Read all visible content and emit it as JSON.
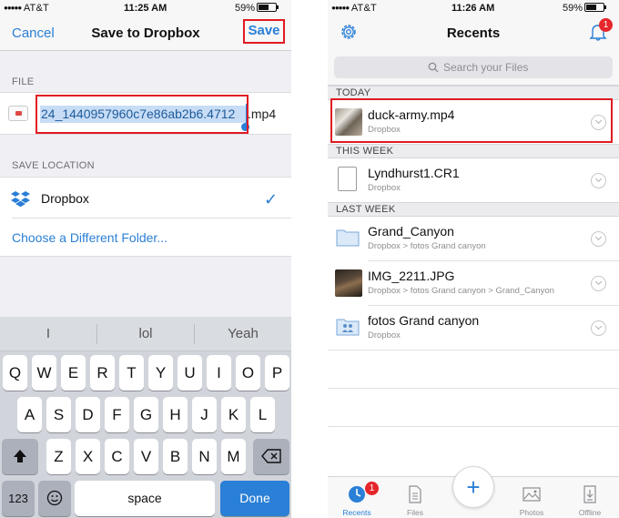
{
  "left": {
    "status": {
      "carrier": "AT&T",
      "time": "11:25 AM",
      "battery": "59%"
    },
    "nav": {
      "cancel": "Cancel",
      "title": "Save to Dropbox",
      "save": "Save"
    },
    "file_section_label": "FILE",
    "file_name": "24_1440957960c7e86ab2b6.4712",
    "file_ext": ".mp4",
    "save_location_label": "SAVE LOCATION",
    "location": "Dropbox",
    "choose_folder": "Choose a Different Folder...",
    "suggestions": [
      "I",
      "lol",
      "Yeah"
    ],
    "keys_row1": [
      "Q",
      "W",
      "E",
      "R",
      "T",
      "Y",
      "U",
      "I",
      "O",
      "P"
    ],
    "keys_row2": [
      "A",
      "S",
      "D",
      "F",
      "G",
      "H",
      "J",
      "K",
      "L"
    ],
    "keys_row3": [
      "Z",
      "X",
      "C",
      "V",
      "B",
      "N",
      "M"
    ],
    "key_123": "123",
    "key_space": "space",
    "key_done": "Done"
  },
  "right": {
    "status": {
      "carrier": "AT&T",
      "time": "11:26 AM",
      "battery": "59%"
    },
    "title": "Recents",
    "notification_count": "1",
    "search_placeholder": "Search your Files",
    "groups": {
      "today": "TODAY",
      "this_week": "THIS WEEK",
      "last_week": "LAST WEEK"
    },
    "files": [
      {
        "name": "duck-army.mp4",
        "path": "Dropbox"
      },
      {
        "name": "Lyndhurst1.CR1",
        "path": "Dropbox"
      },
      {
        "name": "Grand_Canyon",
        "path": "Dropbox > fotos Grand canyon"
      },
      {
        "name": "IMG_2211.JPG",
        "path": "Dropbox > fotos Grand canyon > Grand_Canyon"
      },
      {
        "name": "fotos Grand canyon",
        "path": "Dropbox"
      }
    ],
    "tabs": [
      {
        "label": "Recents",
        "badge": "1"
      },
      {
        "label": "Files"
      },
      {
        "label": "Photos"
      },
      {
        "label": "Offline"
      }
    ],
    "fab": "+"
  }
}
